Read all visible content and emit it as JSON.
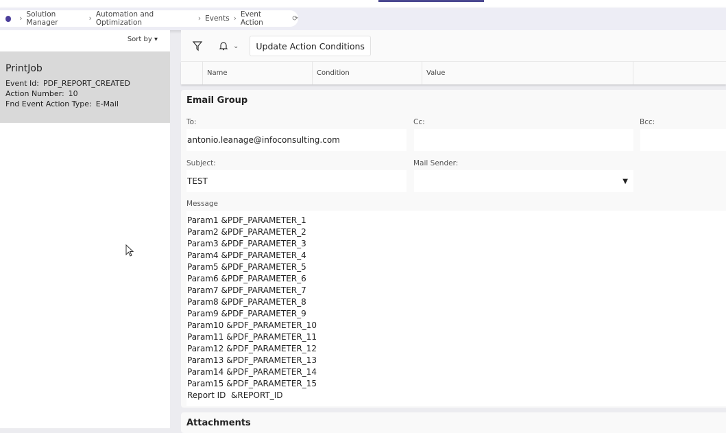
{
  "breadcrumb": [
    "Solution Manager",
    "Automation and Optimization",
    "Events",
    "Event Action"
  ],
  "left": {
    "sort_label": "Sort by",
    "card": {
      "title": "PrintJob",
      "fields": [
        {
          "label": "Event Id:",
          "value": "PDF_REPORT_CREATED"
        },
        {
          "label": "Action Number:",
          "value": "10"
        },
        {
          "label": "Fnd Event Action Type:",
          "value": "E-Mail"
        }
      ]
    }
  },
  "toolbar": {
    "update_label": "Update Action Conditions"
  },
  "table": {
    "columns": [
      "Name",
      "Condition",
      "Value"
    ]
  },
  "email": {
    "title": "Email Group",
    "to_label": "To:",
    "to": "antonio.leanage@infoconsulting.com",
    "cc_label": "Cc:",
    "cc": "",
    "bcc_label": "Bcc:",
    "bcc": "",
    "subject_label": "Subject:",
    "subject": "TEST",
    "sender_label": "Mail Sender:",
    "sender": "",
    "message_label": "Message",
    "message": "Param1 &PDF_PARAMETER_1\nParam2 &PDF_PARAMETER_2\nParam3 &PDF_PARAMETER_3\nParam4 &PDF_PARAMETER_4\nParam5 &PDF_PARAMETER_5\nParam6 &PDF_PARAMETER_6\nParam7 &PDF_PARAMETER_7\nParam8 &PDF_PARAMETER_8\nParam9 &PDF_PARAMETER_9\nParam10 &PDF_PARAMETER_10\nParam11 &PDF_PARAMETER_11\nParam12 &PDF_PARAMETER_12\nParam13 &PDF_PARAMETER_13\nParam14 &PDF_PARAMETER_14\nParam15 &PDF_PARAMETER_15\nReport ID  &REPORT_ID"
  },
  "attachments": {
    "title": "Attachments"
  }
}
